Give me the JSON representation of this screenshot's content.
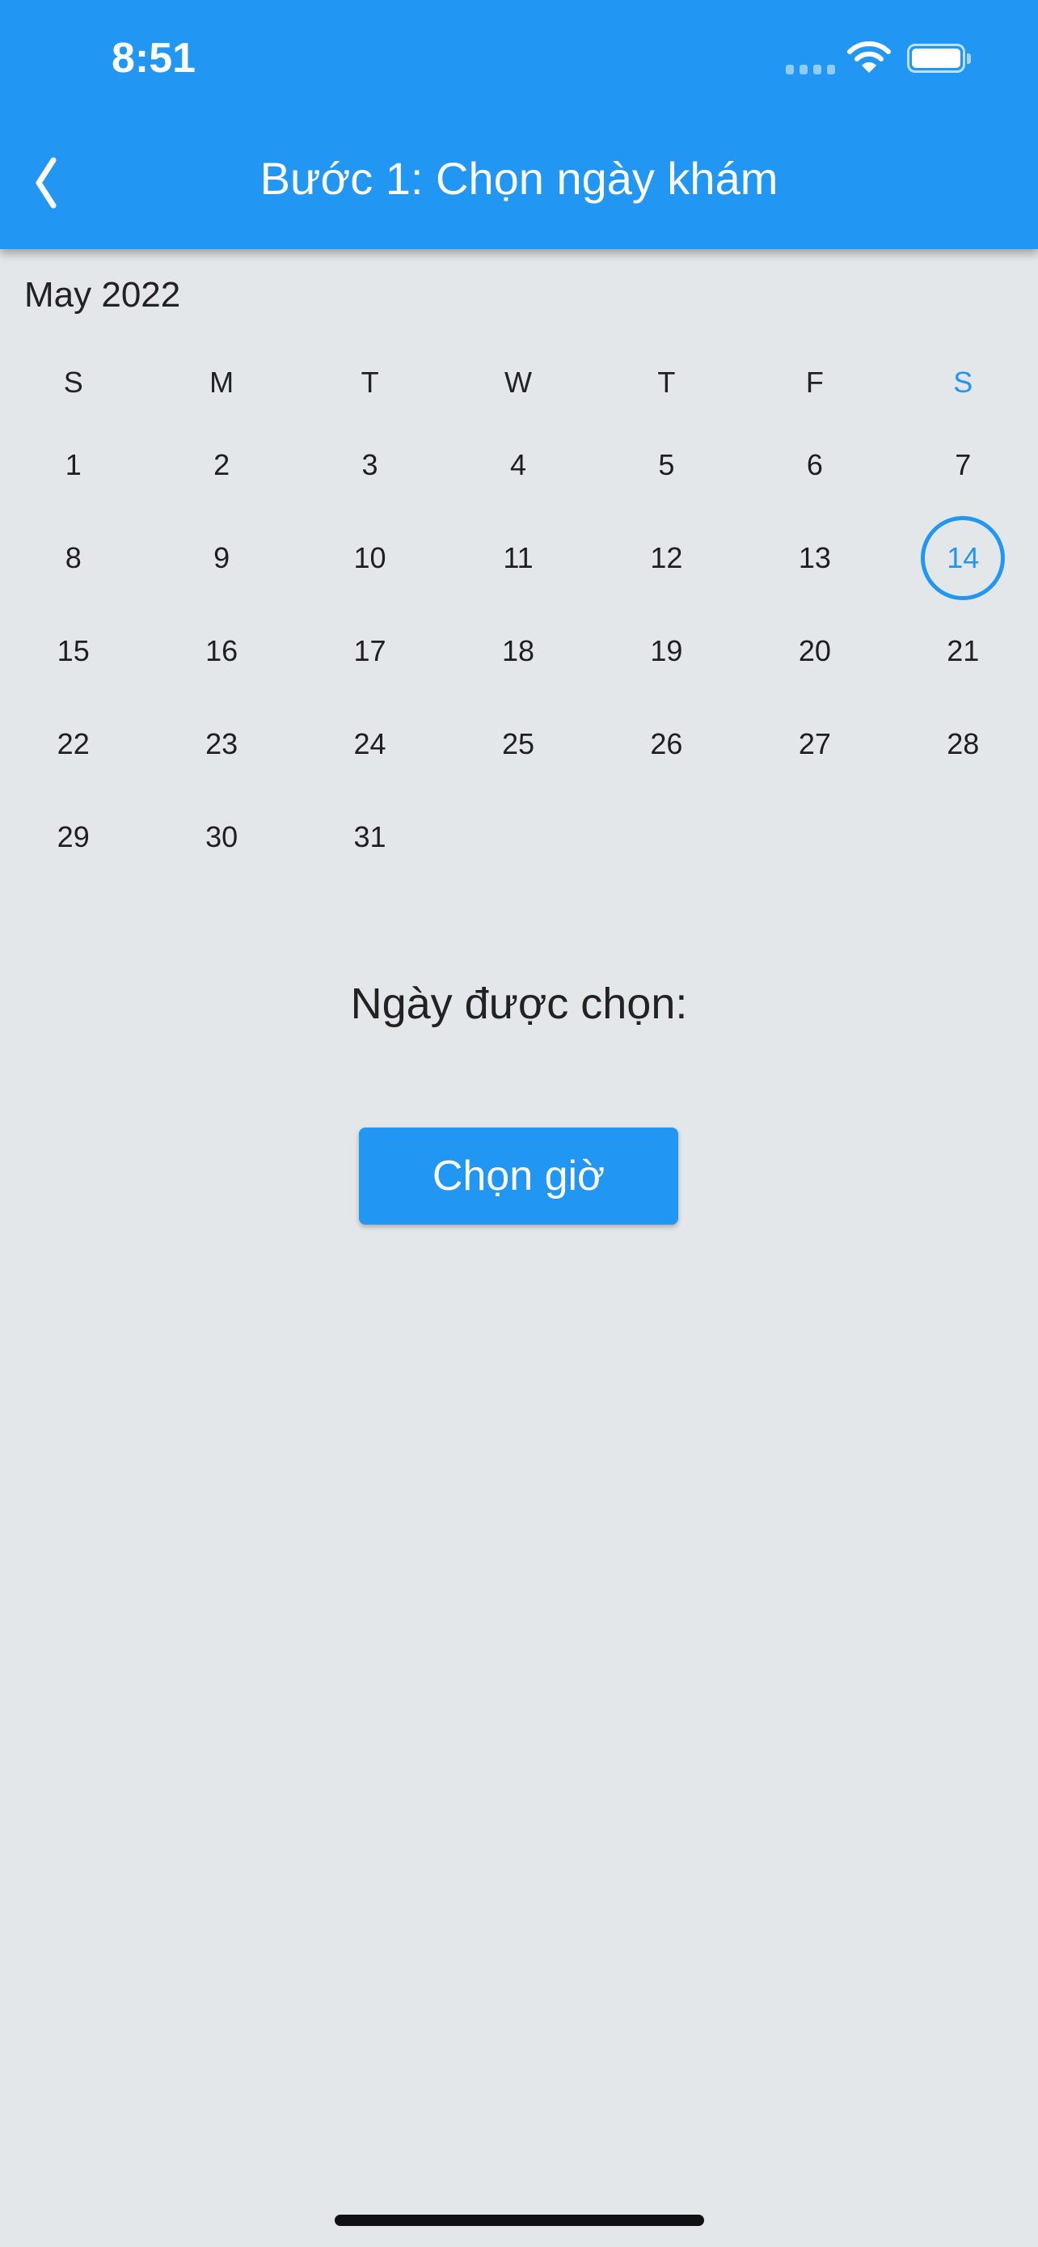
{
  "status_bar": {
    "time": "8:51",
    "icons": [
      "signal-icon",
      "wifi-icon",
      "battery-icon"
    ]
  },
  "app_bar": {
    "title": "Bước 1: Chọn ngày khám",
    "back_icon": "chevron-left-icon"
  },
  "calendar": {
    "month_label": "May 2022",
    "weekdays": [
      "S",
      "M",
      "T",
      "W",
      "T",
      "F",
      "S"
    ],
    "first_weekday_index": 0,
    "days_in_month": 31,
    "selected_day": "14",
    "highlight_weekday_index": 6
  },
  "selected_date_label": "Ngày được chọn:",
  "choose_time_button": "Chọn giờ",
  "colors": {
    "primary": "#2196f3",
    "background": "#e3e7ea"
  }
}
